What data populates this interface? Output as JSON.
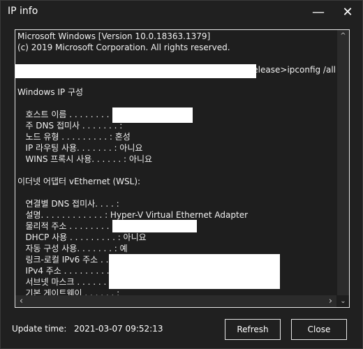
{
  "window": {
    "title": "IP info",
    "minimize_icon": "minimize-icon",
    "close_icon": "close-icon"
  },
  "console": {
    "lines": [
      "Microsoft Windows [Version 10.0.18363.1379]",
      "(c) 2019 Microsoft Corporation. All rights reserved.",
      "",
      "                                                                                    Release>ipconfig /all",
      "",
      "Windows IP 구성",
      "",
      "   호스트 이름 . . . . . . . . :",
      "   주 DNS 접미사 . . . . . . . :",
      "   노드 유형 . . . . . . . . . : 혼성",
      "   IP 라우팅 사용. . . . . . . : 아니요",
      "   WINS 프록시 사용. . . . . . : 아니요",
      "",
      "이더넷 어댑터 vEthernet (WSL):",
      "",
      "   연결별 DNS 접미사. . . . :",
      "   설명. . . . . . . . . . . . : Hyper-V Virtual Ethernet Adapter",
      "   물리적 주소 . . . . . . . . :",
      "   DHCP 사용 . . . . . . . . . : 아니요",
      "   자동 구성 사용. . . . . . . : 예",
      "   링크-로컬 IPv6 주소 . . . . :",
      "   IPv4 주소 . . . . . . . . . :",
      "   서브넷 마스크 . . . . . . . :",
      "   기본 게이트웨이 . . . . . . :"
    ]
  },
  "footer": {
    "update_label": "Update time:",
    "update_time": "2021-03-07 09:52:13",
    "refresh_label": "Refresh",
    "close_label": "Close"
  }
}
